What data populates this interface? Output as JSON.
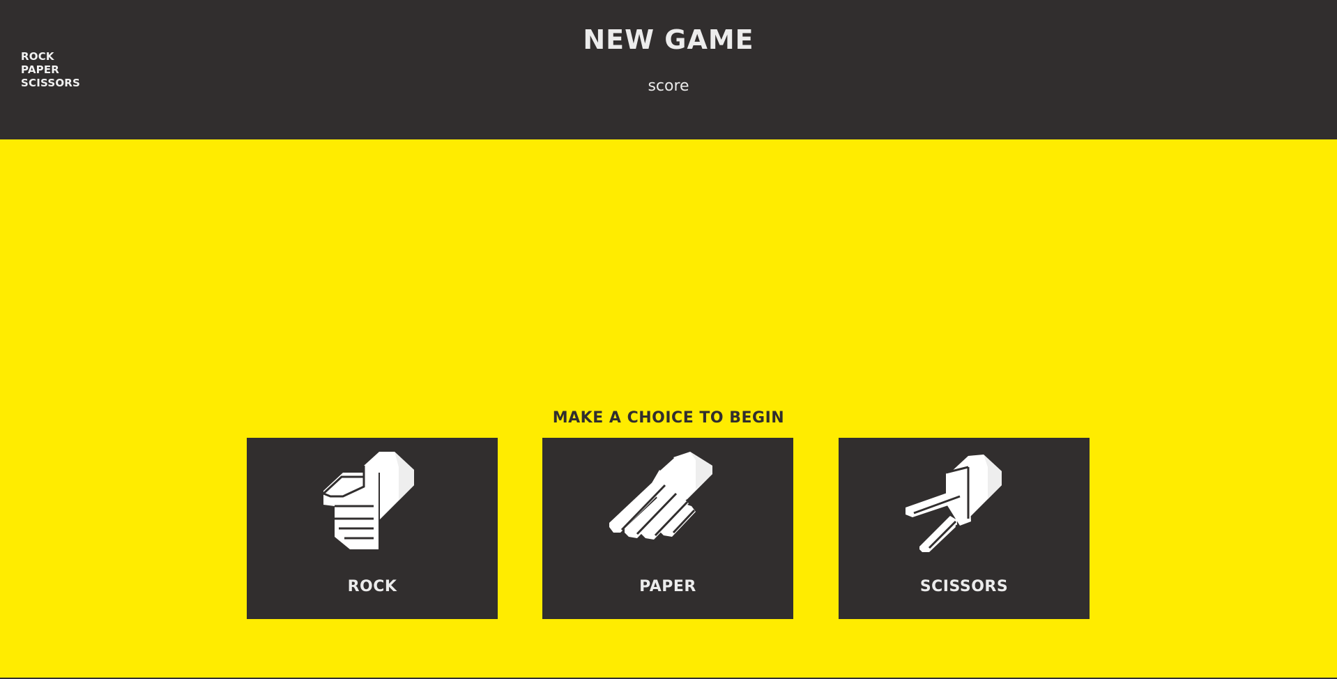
{
  "logo": {
    "lines": [
      "ROCK",
      "PAPER",
      "SCISSORS"
    ]
  },
  "header": {
    "title": "NEW GAME",
    "score_label": "score"
  },
  "prompt": "MAKE A CHOICE TO BEGIN",
  "choices": [
    {
      "label": "ROCK",
      "icon": "rock-hand-icon"
    },
    {
      "label": "PAPER",
      "icon": "paper-hand-icon"
    },
    {
      "label": "SCISSORS",
      "icon": "scissors-hand-icon"
    }
  ],
  "colors": {
    "background": "#ffec00",
    "panel": "#312e2e",
    "text_light": "#ececec",
    "icon": "#ffffff"
  }
}
